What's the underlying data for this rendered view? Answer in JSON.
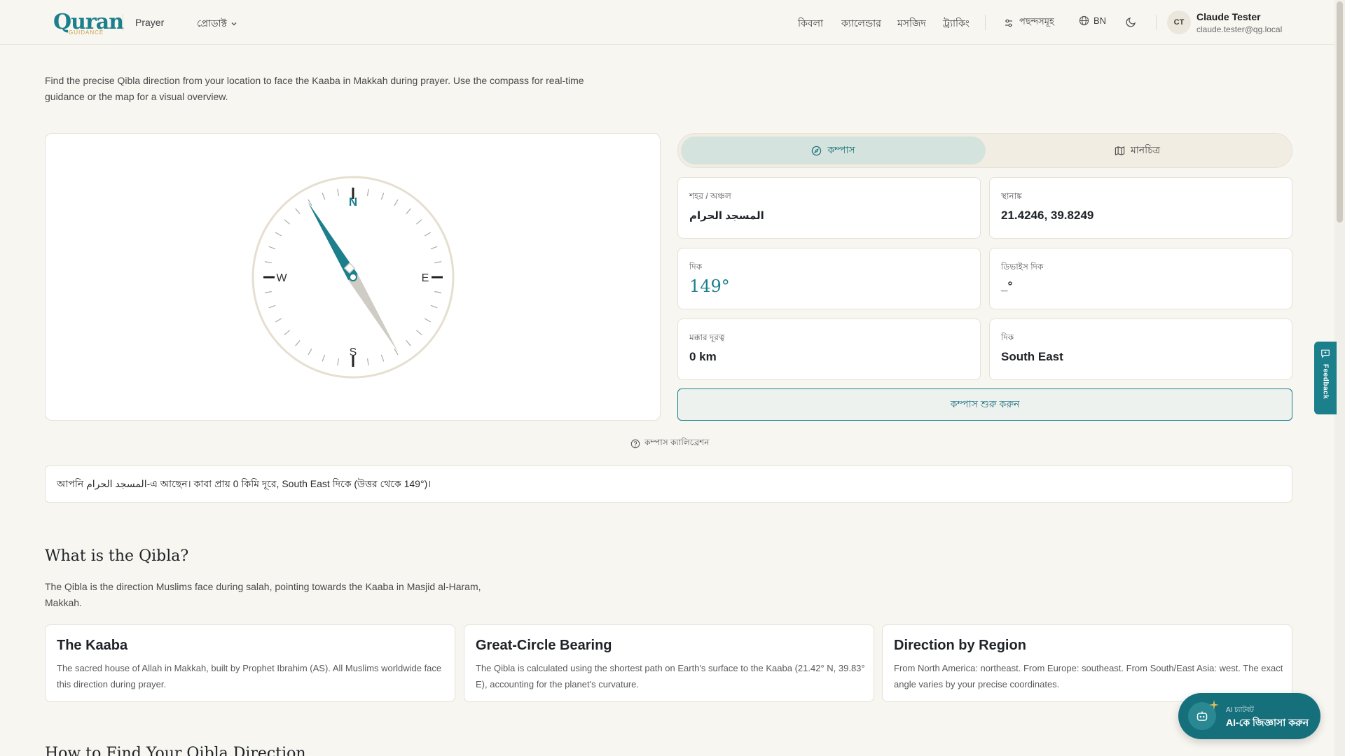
{
  "header": {
    "logo_text": "Quran",
    "logo_sub": "GUIDANCE",
    "nav_prayer": "Prayer",
    "nav_products": "প্রোডাক্ট",
    "nav_links": [
      "কিবলা",
      "ক্যালেন্ডার",
      "মসজিদ",
      "ট্র্যাকিং"
    ],
    "preferences": "পছন্দসমূহ",
    "language": "BN",
    "user": {
      "initials": "CT",
      "name": "Claude Tester",
      "email": "claude.tester@qg.local"
    }
  },
  "intro": "Find the precise Qibla direction from your location to face the Kaaba in Makkah during prayer. Use the compass for real-time guidance or the map for a visual overview.",
  "compass": {
    "bearing_deg": 149,
    "labels": {
      "n": "N",
      "e": "E",
      "s": "S",
      "w": "W"
    }
  },
  "tabs": {
    "compass": "কম্পাস",
    "map": "মানচিত্র"
  },
  "info": {
    "city_label": "শহর / অঞ্চল",
    "city_value": "المسجد الحرام",
    "coords_label": "স্থানাঙ্ক",
    "coords_value": "21.4246, 39.8249",
    "direction_label": "দিক",
    "direction_value": "149°",
    "device_label": "ডিভাইস দিক",
    "device_value": "_°",
    "distance_label": "মক্কার দূরত্ব",
    "distance_value": "0 km",
    "cardinal_label": "দিক",
    "cardinal_value": "South East"
  },
  "start_button": "কম্পাস শুরু করুন",
  "calibration": "কম্পাস ক্যালিব্রেশন",
  "summary": "আপনি المسجد الحرام-এ আছেন। কাবা প্রায় 0 কিমি দূরে, South East দিকে (উত্তর থেকে 149°)।",
  "qibla_section": {
    "title": "What is the Qibla?",
    "description": "The Qibla is the direction Muslims face during salah, pointing towards the Kaaba in Masjid al-Haram, Makkah.",
    "features": [
      {
        "title": "The Kaaba",
        "text": "The sacred house of Allah in Makkah, built by Prophet Ibrahim (AS). All Muslims worldwide face this direction during prayer."
      },
      {
        "title": "Great-Circle Bearing",
        "text": "The Qibla is calculated using the shortest path on Earth's surface to the Kaaba (21.42° N, 39.83° E), accounting for the planet's curvature."
      },
      {
        "title": "Direction by Region",
        "text": "From North America: northeast. From Europe: southeast. From South/East Asia: west. The exact angle varies by your precise coordinates."
      }
    ]
  },
  "next_section_title": "How to Find Your Qibla Direction",
  "feedback": "Feedback",
  "ai": {
    "small": "AI চ্যাটবট",
    "big": "AI-কে জিজ্ঞাসা করুন"
  },
  "colors": {
    "accent": "#1b7f8c",
    "background": "#f8f6f1",
    "card": "#ffffff"
  }
}
